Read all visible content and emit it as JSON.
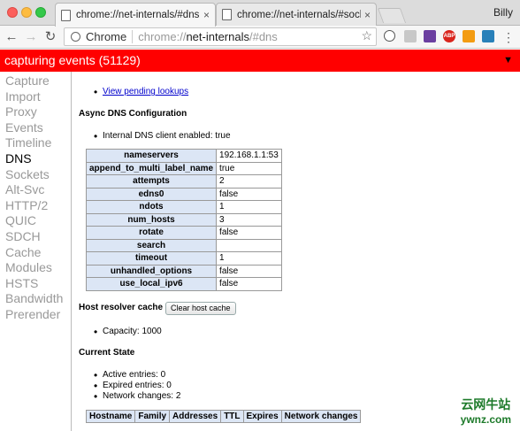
{
  "window": {
    "profile_name": "Billy"
  },
  "tabs": [
    {
      "title": "chrome://net-internals/#dns",
      "close": "×"
    },
    {
      "title": "chrome://net-internals/#sockets",
      "close": "×"
    }
  ],
  "toolbar": {
    "back": "←",
    "forward": "→",
    "reload": "↻",
    "omnibox_chip": "Chrome",
    "url_prefix": "chrome://",
    "url_host": "net-internals",
    "url_suffix": "/#dns",
    "star": "☆",
    "menu": "⋮",
    "ext_abp": "ABP"
  },
  "capture_bar": {
    "text": "capturing events (51129)",
    "caret": "▼"
  },
  "sidebar": {
    "items": [
      "Capture",
      "Import",
      "Proxy",
      "Events",
      "Timeline",
      "DNS",
      "Sockets",
      "Alt-Svc",
      "HTTP/2",
      "QUIC",
      "SDCH",
      "Cache",
      "Modules",
      "HSTS",
      "Bandwidth",
      "Prerender"
    ],
    "active": "DNS"
  },
  "main": {
    "pending_link": "View pending lookups",
    "async_heading": "Async DNS Configuration",
    "internal_client": "Internal DNS client enabled: true",
    "config": [
      {
        "key": "nameservers",
        "value": "192.168.1.1:53"
      },
      {
        "key": "append_to_multi_label_name",
        "value": "true"
      },
      {
        "key": "attempts",
        "value": "2"
      },
      {
        "key": "edns0",
        "value": "false"
      },
      {
        "key": "ndots",
        "value": "1"
      },
      {
        "key": "num_hosts",
        "value": "3"
      },
      {
        "key": "rotate",
        "value": "false"
      },
      {
        "key": "search",
        "value": ""
      },
      {
        "key": "timeout",
        "value": "1"
      },
      {
        "key": "unhandled_options",
        "value": "false"
      },
      {
        "key": "use_local_ipv6",
        "value": "false"
      }
    ],
    "cache_heading": "Host resolver cache",
    "clear_button": "Clear host cache",
    "capacity": "Capacity: 1000",
    "state_heading": "Current State",
    "state": [
      "Active entries: 0",
      "Expired entries: 0",
      "Network changes: 2"
    ],
    "table_headers": [
      "Hostname",
      "Family",
      "Addresses",
      "TTL",
      "Expires",
      "Network changes"
    ]
  },
  "watermark": {
    "line1": "云网牛站",
    "line2": "ywnz.com"
  }
}
